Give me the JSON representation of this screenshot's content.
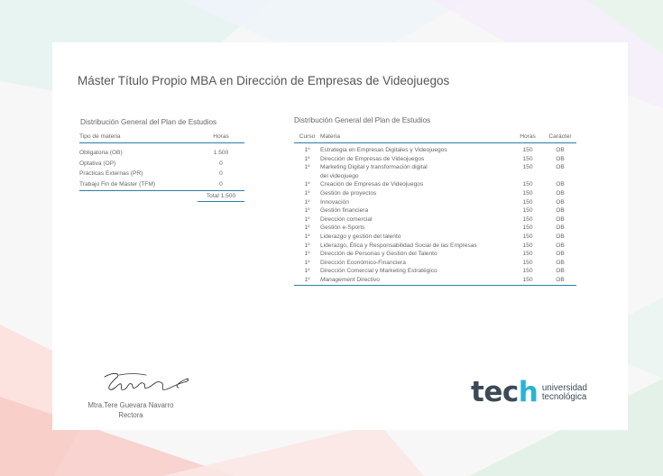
{
  "header": {
    "title": "Máster Título Propio MBA en Dirección de Empresas de Videojuegos"
  },
  "summary": {
    "section_title": "Distribución General del Plan de Estudios",
    "columns": [
      "Tipo de materia",
      "Horas"
    ],
    "rows": [
      {
        "tipo": "Obligatoria (OB)",
        "horas": "1.500"
      },
      {
        "tipo": "Optativa (OP)",
        "horas": "0"
      },
      {
        "tipo": "Prácticas Externas (PR)",
        "horas": "0"
      },
      {
        "tipo": "Trabajo Fin de Máster (TFM)",
        "horas": "0"
      }
    ],
    "total": "Total 1.500"
  },
  "plan": {
    "section_title": "Distribución General del Plan de Estudios",
    "columns": [
      "Curso",
      "Materia",
      "Horas",
      "Carácter"
    ],
    "rows": [
      {
        "curso": "1º",
        "materia": "Estrategia en Empresas Digitales y Videojuegos",
        "horas": "150",
        "caracter": "OB"
      },
      {
        "curso": "1º",
        "materia": "Dirección de Empresas de Videojuegos",
        "horas": "150",
        "caracter": "OB"
      },
      {
        "curso": "1º",
        "materia": "Marketing Digital y transformación digital",
        "materia2": "del videojuego",
        "horas": "150",
        "caracter": "OB"
      },
      {
        "curso": "1º",
        "materia": "Creación de Empresas de Videojuegos",
        "horas": "150",
        "caracter": "OB"
      },
      {
        "curso": "1º",
        "materia": "Gestión de proyectos",
        "horas": "150",
        "caracter": "OB"
      },
      {
        "curso": "1º",
        "materia": "Innovación",
        "horas": "150",
        "caracter": "OB"
      },
      {
        "curso": "1º",
        "materia": "Gestión financiera",
        "horas": "150",
        "caracter": "OB"
      },
      {
        "curso": "1º",
        "materia": "Dirección comercial",
        "horas": "150",
        "caracter": "OB"
      },
      {
        "curso": "1º",
        "materia": "Gestión e-Sports",
        "horas": "150",
        "caracter": "OB"
      },
      {
        "curso": "1º",
        "materia": "Liderazgo y gestión del talento",
        "horas": "150",
        "caracter": "OB"
      },
      {
        "curso": "1º",
        "materia": "Liderazgo, Ética y Responsabilidad Social de las Empresas",
        "horas": "150",
        "caracter": "OB"
      },
      {
        "curso": "1º",
        "materia": "Dirección de Personas y Gestión del Talento",
        "horas": "150",
        "caracter": "OB"
      },
      {
        "curso": "1º",
        "materia": "Dirección Económico-Financiera",
        "horas": "150",
        "caracter": "OB"
      },
      {
        "curso": "1º",
        "materia": "Dirección Comercial y Marketing Estratégico",
        "horas": "150",
        "caracter": "OB"
      },
      {
        "curso": "1º",
        "materia_italic": "Management",
        "materia": " Directivo",
        "horas": "150",
        "caracter": "OB"
      }
    ]
  },
  "signature": {
    "name": "Mtra.Tere Guevara Navarro",
    "role": "Rectora"
  },
  "logo": {
    "wordmark_a": "tec",
    "wordmark_b": "h",
    "line1": "universidad",
    "line2": "tecnológica",
    "colors": {
      "dark": "#3b4a56",
      "accent": "#28b4d4"
    }
  },
  "colors": {
    "rule": "#2a7fa8"
  }
}
